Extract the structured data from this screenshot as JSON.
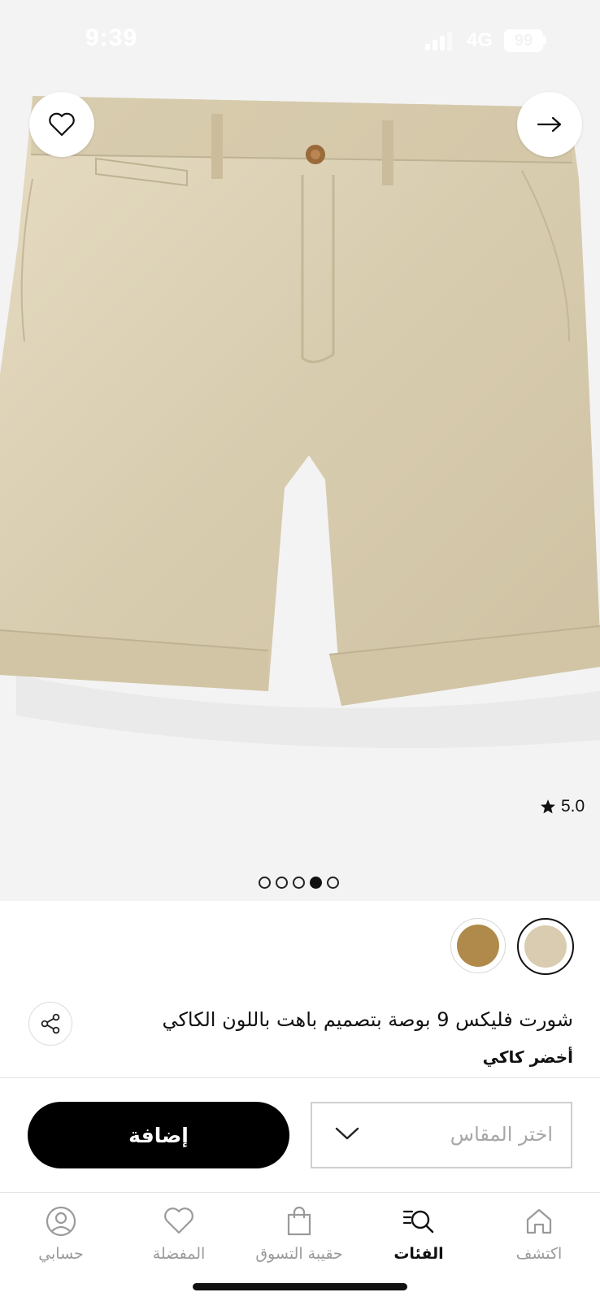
{
  "status_bar": {
    "time": "9:39",
    "network": "4G",
    "battery": "99"
  },
  "product": {
    "title": "شورت فليكس 9 بوصة بتصميم باهت باللون الكاكي",
    "color_name": "أخضر كاكي",
    "rating": "5.0",
    "image_count": 5,
    "active_image": 4,
    "swatches": [
      {
        "name": "khaki",
        "color": "#d9ccb0",
        "selected": true
      },
      {
        "name": "tan",
        "color": "#b08a4a",
        "selected": false
      }
    ]
  },
  "actions": {
    "add_label": "إضافة",
    "size_placeholder": "اختر المقاس"
  },
  "tabbar": {
    "items": [
      {
        "label": "اكتشف",
        "icon": "home-icon",
        "active": false
      },
      {
        "label": "الفئات",
        "icon": "categories-search-icon",
        "active": true
      },
      {
        "label": "حقيبة التسوق",
        "icon": "shopping-bag-icon",
        "active": false
      },
      {
        "label": "المفضلة",
        "icon": "heart-icon",
        "active": false
      },
      {
        "label": "حسابي",
        "icon": "profile-icon",
        "active": false
      }
    ]
  },
  "colors": {
    "accent": "#000000",
    "background": "#f3f3f3",
    "khaki": "#d9ccb0"
  }
}
